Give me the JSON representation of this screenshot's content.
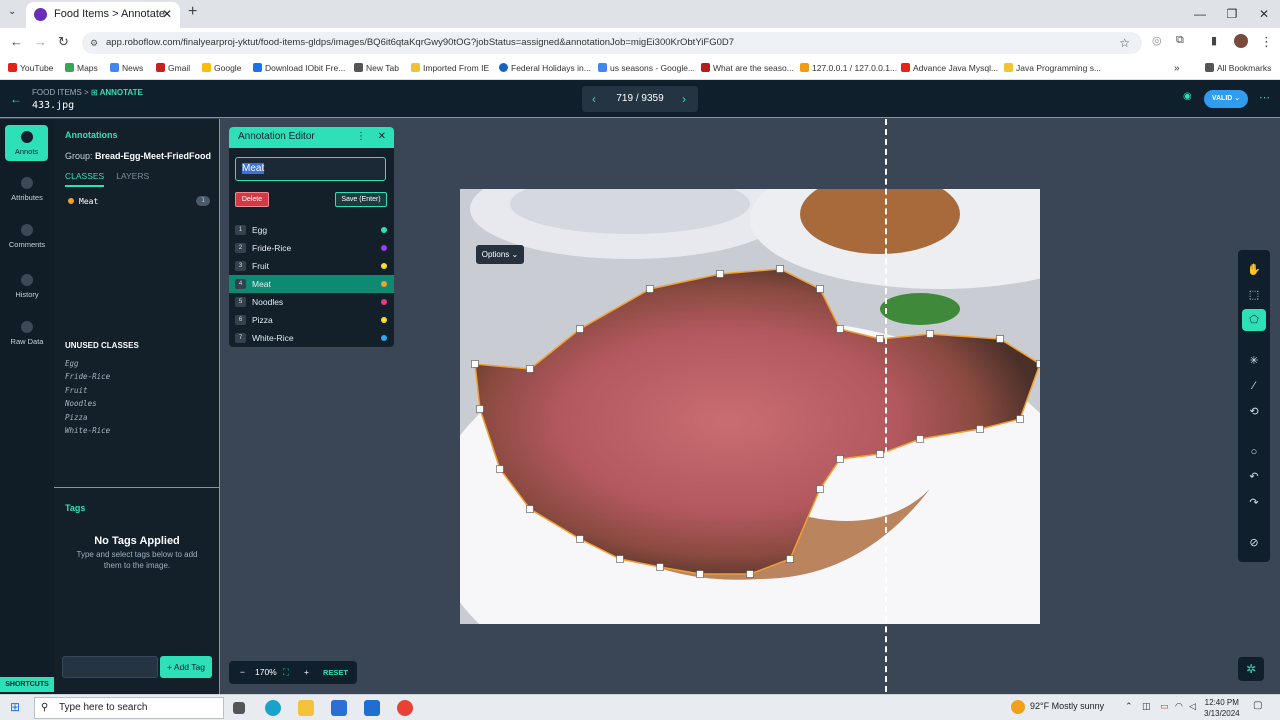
{
  "browser": {
    "tab_title": "Food Items > Annotate",
    "url": "app.roboflow.com/finalyearproj-yktut/food-items-gldps/images/BQ6it6qtaKqrGwy90tOG?jobStatus=assigned&annotationJob=migEi300KrObtYiFG0D7",
    "bookmarks": [
      "YouTube",
      "Maps",
      "News",
      "Gmail",
      "Google",
      "Download IObit Fre...",
      "New Tab",
      "Imported From IE",
      "Federal Holidays in...",
      "us seasons - Google...",
      "What are the seaso...",
      "127.0.0.1 / 127.0.0.1...",
      "Advance Java Mysql...",
      "Java Programming s..."
    ],
    "all_bookmarks": "All Bookmarks"
  },
  "header": {
    "crumb_project": "FOOD ITEMS",
    "crumb_sep": ">",
    "crumb_mode": "ANNOTATE",
    "filename": "433.jpg",
    "pager": "719 / 9359",
    "status": "VALID"
  },
  "rail": {
    "annots": "Annots",
    "attributes": "Attributes",
    "comments": "Comments",
    "history": "History",
    "raw_data": "Raw Data",
    "shortcuts": "SHORTCUTS"
  },
  "panel": {
    "title": "Annotations",
    "group_label": "Group:",
    "group_value": "Bread-Egg-Meet-FriedFood",
    "tab_classes": "CLASSES",
    "tab_layers": "LAYERS",
    "used_class": {
      "name": "Meat",
      "count": "1"
    },
    "unused_title": "UNUSED CLASSES",
    "unused": [
      "Egg",
      "Fride-Rice",
      "Fruit",
      "Noodles",
      "Pizza",
      "White-Rice"
    ],
    "tags_title": "Tags",
    "no_tags": "No Tags Applied",
    "no_tags_sub": "Type and select tags below to add them to the image.",
    "add_tag": "+ Add Tag"
  },
  "editor": {
    "title": "Annotation Editor",
    "input_value": "Meat",
    "delete": "Delete",
    "save": "Save (Enter)",
    "classes": [
      {
        "num": "1",
        "name": "Egg",
        "color": "#2ee0b8"
      },
      {
        "num": "2",
        "name": "Fride-Rice",
        "color": "#9b3df0"
      },
      {
        "num": "3",
        "name": "Fruit",
        "color": "#f5e12a"
      },
      {
        "num": "4",
        "name": "Meat",
        "color": "#f0a030"
      },
      {
        "num": "5",
        "name": "Noodles",
        "color": "#e83a8a"
      },
      {
        "num": "6",
        "name": "Pizza",
        "color": "#f5e12a"
      },
      {
        "num": "7",
        "name": "White-Rice",
        "color": "#2fa8f0"
      }
    ],
    "selected_index": 3
  },
  "canvas": {
    "options": "Options"
  },
  "zoom": {
    "level": "170%",
    "reset": "RESET"
  },
  "taskbar": {
    "search_placeholder": "Type here to search",
    "weather": "92°F  Mostly sunny",
    "time": "12:40 PM",
    "date": "3/13/2024"
  }
}
